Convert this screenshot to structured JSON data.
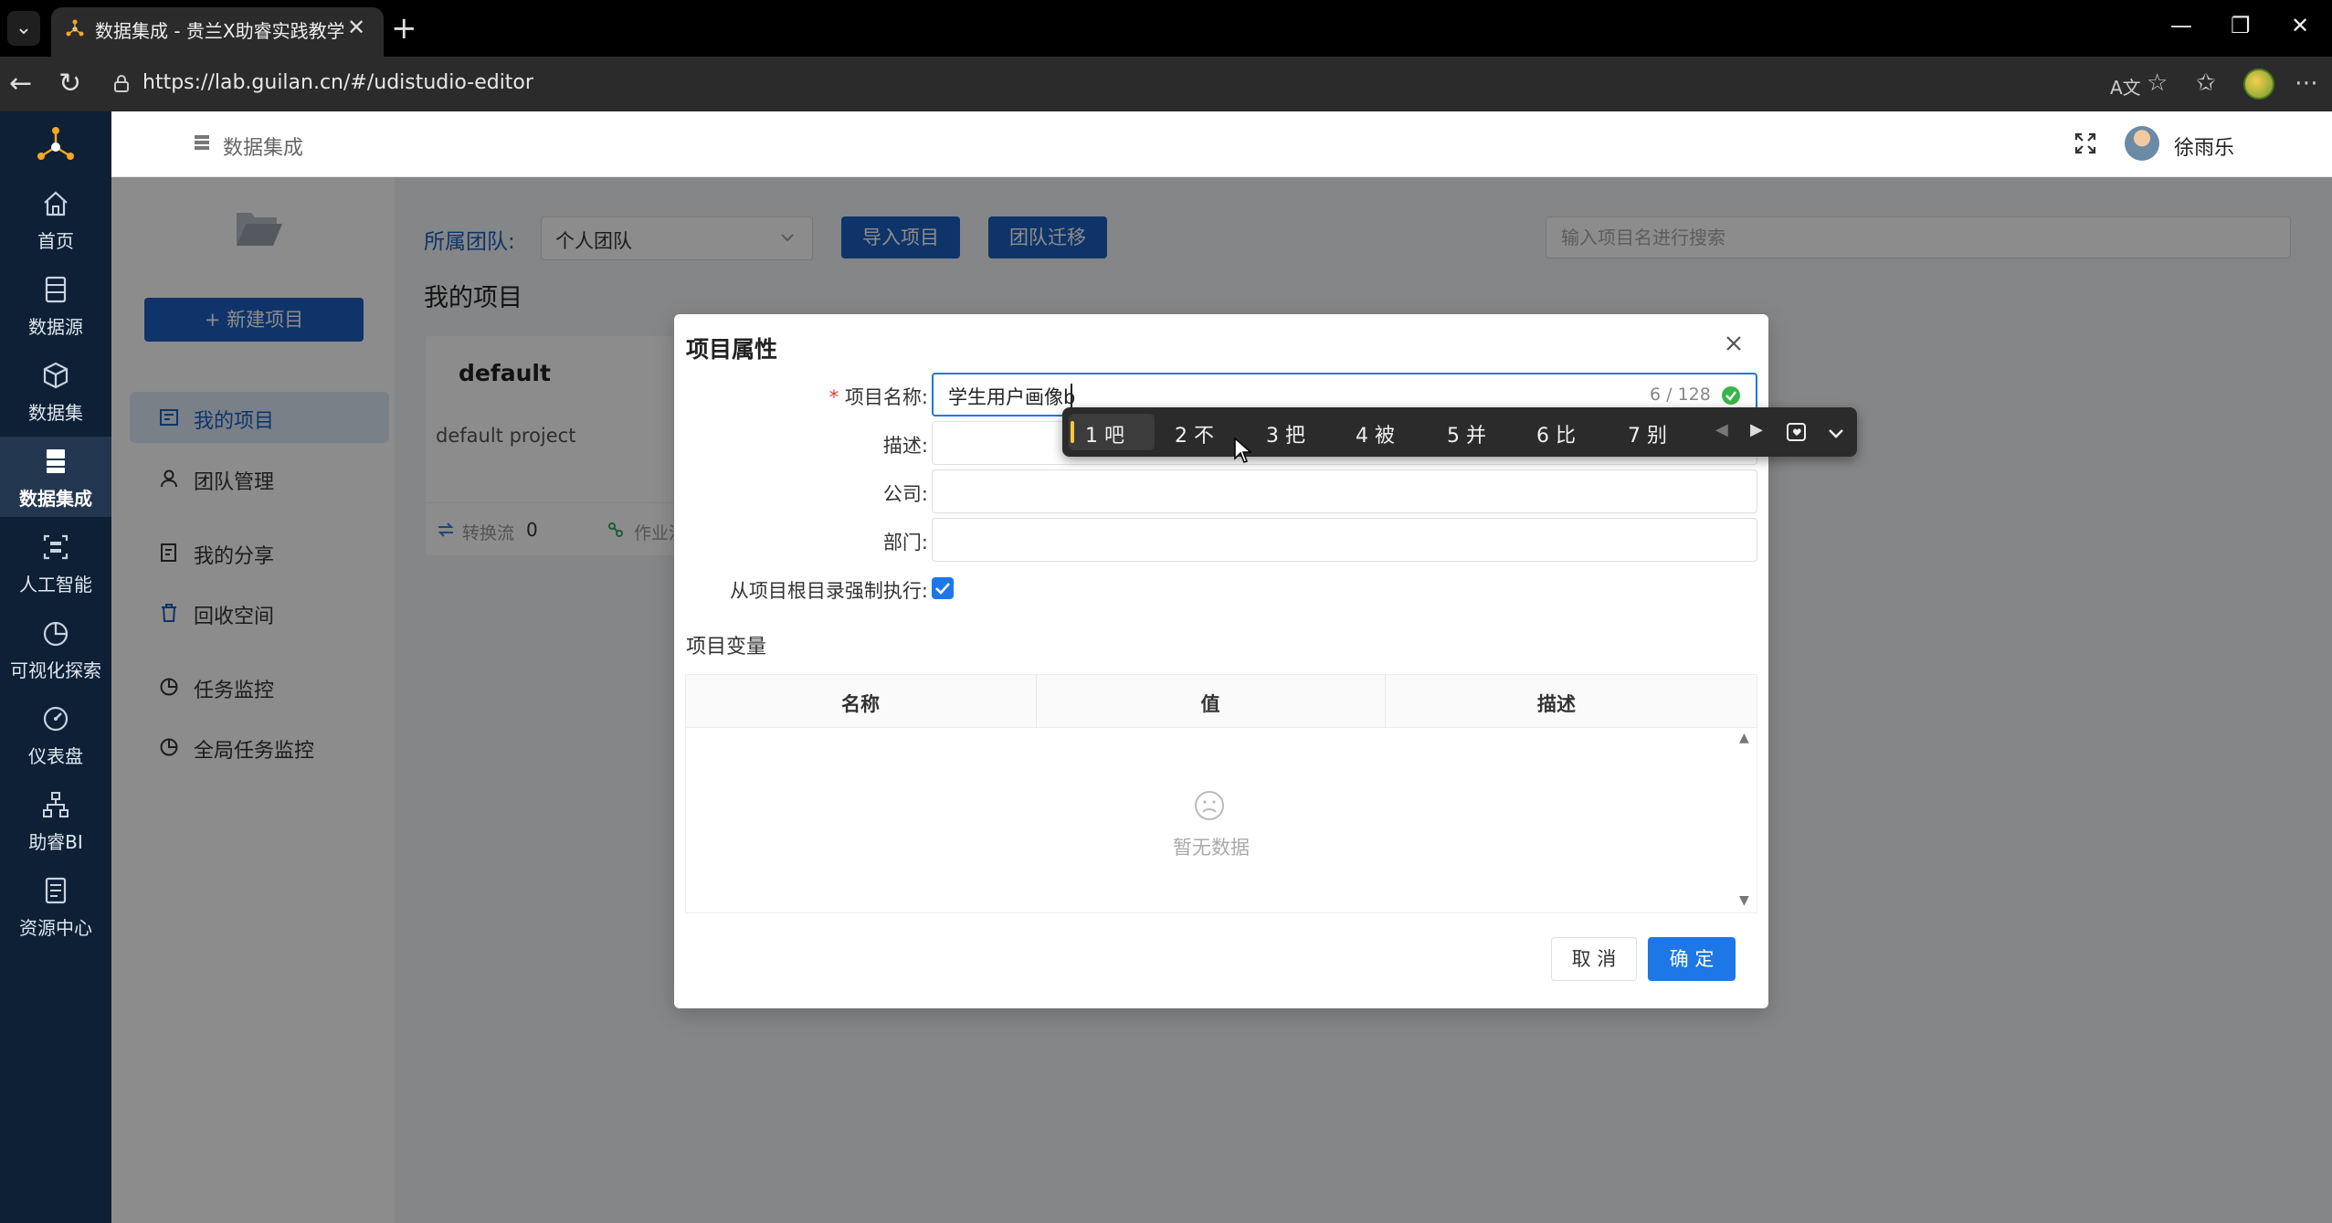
{
  "browser": {
    "tab_title": "数据集成 - 贵兰X助睿实践教学平台",
    "url": "https://lab.guilan.cn/#/udistudio-editor"
  },
  "sidebar": {
    "items": [
      {
        "label": "首页",
        "icon": "home-icon"
      },
      {
        "label": "数据源",
        "icon": "database-icon"
      },
      {
        "label": "数据集",
        "icon": "cube-icon"
      },
      {
        "label": "数据集成",
        "icon": "server-icon",
        "active": true
      },
      {
        "label": "人工智能",
        "icon": "ai-icon"
      },
      {
        "label": "可视化探索",
        "icon": "pie-icon"
      },
      {
        "label": "仪表盘",
        "icon": "gauge-icon"
      },
      {
        "label": "助睿BI",
        "icon": "org-icon"
      },
      {
        "label": "资源中心",
        "icon": "document-icon"
      }
    ]
  },
  "header": {
    "breadcrumb": "数据集成",
    "user_name": "徐雨乐"
  },
  "left_panel": {
    "new_project": "+ 新建项目",
    "menu": [
      {
        "label": "我的项目",
        "active": true
      },
      {
        "label": "团队管理"
      },
      {
        "label": "我的分享"
      },
      {
        "label": "回收空间"
      },
      {
        "label": "任务监控"
      },
      {
        "label": "全局任务监控"
      }
    ]
  },
  "toolbar": {
    "team_label": "所属团队:",
    "team_value": "个人团队",
    "import_label": "导入项目",
    "migrate_label": "团队迁移",
    "search_placeholder": "输入项目名进行搜索"
  },
  "main": {
    "title": "我的项目",
    "card": {
      "title": "default",
      "desc": "default project",
      "flow_label": "转换流",
      "flow_value": "0",
      "job_label": "作业流"
    }
  },
  "modal": {
    "title": "项目属性",
    "fields": {
      "name_label": "项目名称:",
      "name_value": "学生用户画像b",
      "name_count": "6 / 128",
      "desc_label": "描述:",
      "company_label": "公司:",
      "dept_label": "部门:",
      "force_label": "从项目根目录强制执行:",
      "force_checked": true
    },
    "vars_title": "项目变量",
    "columns": [
      "名称",
      "值",
      "描述"
    ],
    "empty_text": "暂无数据",
    "cancel_label": "取 消",
    "ok_label": "确 定"
  },
  "ime": {
    "candidates": [
      "1 吧",
      "2 不",
      "3 把",
      "4 被",
      "5 并",
      "6 比",
      "7 别"
    ]
  },
  "colors": {
    "primary": "#1d5fbf",
    "accent": "#1d77e6",
    "sidebar_bg": "#0e2036"
  }
}
